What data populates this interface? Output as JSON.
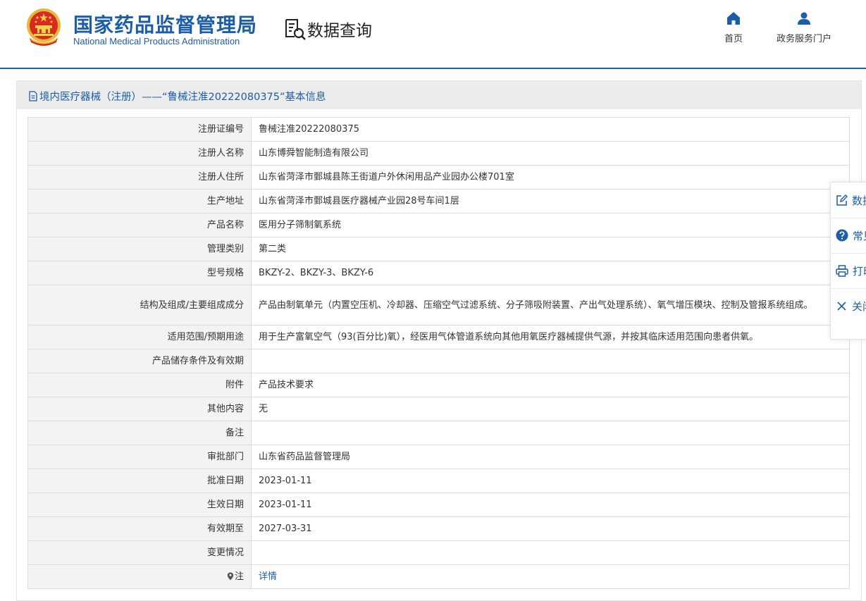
{
  "header": {
    "brand_cn": "国家药品监督管理局",
    "brand_en": "National Medical Products Administration",
    "query_title": "数据查询",
    "nav": [
      {
        "label": "首页",
        "icon": "home-icon"
      },
      {
        "label": "政务服务门户",
        "icon": "user-icon"
      }
    ]
  },
  "panel": {
    "title": "境内医疗器械（注册）——“鲁械注准20222080375”基本信息"
  },
  "table": {
    "rows": [
      {
        "label": "注册证编号",
        "value": "鲁械注准20222080375"
      },
      {
        "label": "注册人名称",
        "value": "山东博舜智能制造有限公司"
      },
      {
        "label": "注册人住所",
        "value": "山东省菏泽市鄄城县陈王街道户外休闲用品产业园办公楼701室"
      },
      {
        "label": "生产地址",
        "value": "山东省菏泽市鄄城县医疗器械产业园28号车间1层"
      },
      {
        "label": "产品名称",
        "value": "医用分子筛制氧系统"
      },
      {
        "label": "管理类别",
        "value": "第二类"
      },
      {
        "label": "型号规格",
        "value": "BKZY-2、BKZY-3、BKZY-6"
      },
      {
        "label": "结构及组成/主要组成成分",
        "value": "产品由制氧单元（内置空压机、冷却器、压缩空气过滤系统、分子筛吸附装置、产出气处理系统）、氧气增压模块、控制及管报系统组成。"
      },
      {
        "label": "适用范围/预期用途",
        "value": "用于生产富氧空气（93(百分比)氧），经医用气体管道系统向其他用氧医疗器械提供气源，并按其临床适用范围向患者供氧。"
      },
      {
        "label": "产品储存条件及有效期",
        "value": ""
      },
      {
        "label": "附件",
        "value": "产品技术要求"
      },
      {
        "label": "其他内容",
        "value": "无"
      },
      {
        "label": "备注",
        "value": ""
      },
      {
        "label": "审批部门",
        "value": "山东省药品监督管理局"
      },
      {
        "label": "批准日期",
        "value": "2023-01-11"
      },
      {
        "label": "生效日期",
        "value": "2023-01-11"
      },
      {
        "label": "有效期至",
        "value": "2027-03-31"
      },
      {
        "label": "变更情况",
        "value": ""
      },
      {
        "label": "注",
        "value": "详情"
      }
    ]
  },
  "side_toolbar": {
    "items": [
      {
        "label": "数据",
        "icon": "edit-icon"
      },
      {
        "label": "常见",
        "icon": "help-icon"
      },
      {
        "label": "打印",
        "icon": "print-icon"
      },
      {
        "label": "关闭",
        "icon": "close-icon"
      }
    ]
  },
  "colors": {
    "brand_blue": "#1b5da8",
    "label_bg": "#f3f3f3",
    "panel_head_bg": "#ececec",
    "border": "#dcdcdc"
  }
}
